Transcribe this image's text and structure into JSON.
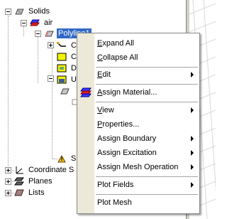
{
  "tree": {
    "items": [
      {
        "label": "Solids",
        "icon": "solids-icon"
      },
      {
        "label": "air",
        "icon": "air-solid-icon"
      },
      {
        "label": "Polyline1",
        "icon": "polyline-solid-icon"
      },
      {
        "label": "C",
        "icon": "create-polyline-icon"
      },
      {
        "label": "C",
        "icon": "covered-icon"
      },
      {
        "label": "D",
        "icon": "operation-icon"
      },
      {
        "label": "U",
        "icon": "unite-icon"
      },
      {
        "label": "S",
        "icon": "sweep-icon"
      },
      {
        "label": "Coordinate S",
        "icon": "coordinate-system-icon"
      },
      {
        "label": "Planes",
        "icon": "planes-icon"
      },
      {
        "label": "Lists",
        "icon": "lists-icon"
      }
    ]
  },
  "context_menu": {
    "items": [
      {
        "label": "Expand All",
        "mnemonic": "E",
        "rest": "xpand All"
      },
      {
        "label": "Collapse All",
        "mnemonic": "C",
        "rest": "ollapse All"
      },
      {
        "label": "Edit",
        "mnemonic": "E",
        "rest": "dit",
        "submenu": true
      },
      {
        "label": "Assign Material...",
        "mnemonic": "A",
        "rest": "ssign Material...",
        "icon": "assign-material-icon"
      },
      {
        "label": "View",
        "mnemonic": "V",
        "rest": "iew",
        "submenu": true
      },
      {
        "label": "Properties...",
        "mnemonic": "P",
        "rest": "roperties..."
      },
      {
        "label": "Assign Boundary",
        "submenu": true
      },
      {
        "label": "Assign Excitation",
        "submenu": true
      },
      {
        "label": "Assign Mesh Operation",
        "submenu": true
      },
      {
        "label": "Plot Fields",
        "submenu": true
      },
      {
        "label": "Plot Mesh"
      }
    ]
  },
  "colors": {
    "selection": "#316ac5",
    "menu_gutter": "#ece9d8",
    "menu_border": "#868686"
  }
}
